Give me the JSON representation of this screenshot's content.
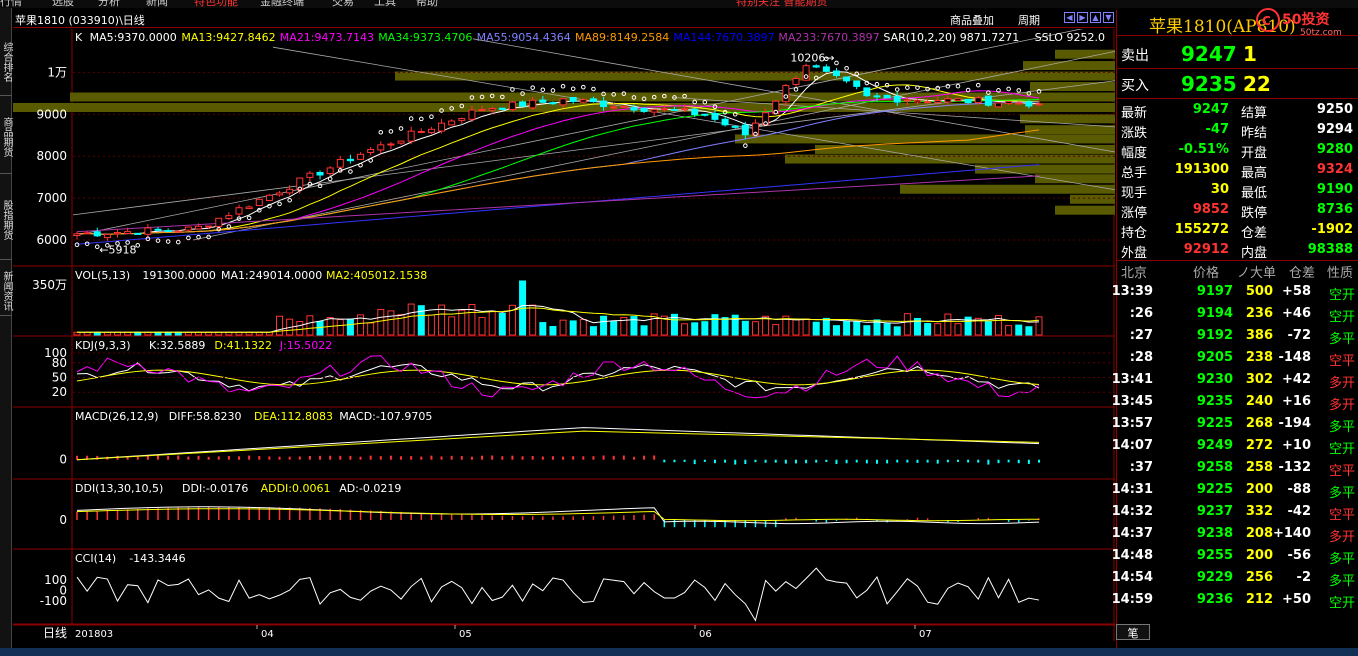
{
  "menu": {
    "items": [
      "行情",
      "选股",
      "分析",
      "新闻",
      "特色功能",
      "金融终端",
      "交易",
      "工具",
      "帮助"
    ],
    "banner": "特别关注 智能期货"
  },
  "side_tabs": [
    "综合排名",
    "商品期货",
    "股指期货",
    "新闻资讯"
  ],
  "toolbar": {
    "title": "苹果1810 (033910)\\日线",
    "overlay": "商品叠加",
    "period": "周期"
  },
  "chart": {
    "indicators": {
      "k": {
        "label": "K",
        "items": [
          {
            "text": "MA5:9370.0000",
            "color": "#ffffff"
          },
          {
            "text": "MA13:9427.8462",
            "color": "#ffff00"
          },
          {
            "text": "MA21:9473.7143",
            "color": "#ff00ff"
          },
          {
            "text": "MA34:9373.4706",
            "color": "#00ff00"
          },
          {
            "text": "MA55:9054.4364",
            "color": "#8080ff"
          },
          {
            "text": "MA89:8149.2584",
            "color": "#ff9900"
          },
          {
            "text": "MA144:7670.3897",
            "color": "#0000ff"
          },
          {
            "text": "MA233:7670.3897",
            "color": "#aa33aa"
          },
          {
            "text": "SAR(10,2,20) 9871.7271",
            "color": "#ffffff"
          },
          {
            "text": "SSLO 9252.0",
            "color": "#ffffff"
          }
        ]
      },
      "vol": {
        "label": "VOL(5,13)",
        "items": [
          {
            "text": "191300.0000",
            "color": "#ffffff"
          },
          {
            "text": "MA1:249014.0000",
            "color": "#ffffff"
          },
          {
            "text": "MA2:405012.1538",
            "color": "#ffff00"
          }
        ]
      },
      "kdj": {
        "label": "KDJ(9,3,3)",
        "items": [
          {
            "text": "K:32.5889",
            "color": "#ffffff"
          },
          {
            "text": "D:41.1322",
            "color": "#ffff00"
          },
          {
            "text": "J:15.5022",
            "color": "#ff00ff"
          }
        ]
      },
      "macd": {
        "label": "MACD(26,12,9)",
        "items": [
          {
            "text": "DIFF:58.8230",
            "color": "#ffffff"
          },
          {
            "text": "DEA:112.8083",
            "color": "#ffff00"
          },
          {
            "text": "MACD:-107.9705",
            "color": "#ffffff"
          }
        ]
      },
      "ddi": {
        "label": "DDI(13,30,10,5)",
        "items": [
          {
            "text": "DDI:-0.0176",
            "color": "#ffffff"
          },
          {
            "text": "ADDI:0.0061",
            "color": "#ffff00"
          },
          {
            "text": "AD:-0.0219",
            "color": "#ffffff"
          }
        ]
      },
      "cci": {
        "label": "CCI(14)",
        "items": [
          {
            "text": "-143.3446",
            "color": "#ffffff"
          }
        ]
      }
    },
    "price_axis": [
      "1万",
      "9000",
      "8000",
      "7000",
      "6000"
    ],
    "vol_axis": [
      "350万"
    ],
    "kdj_axis": [
      "100",
      "80",
      "50",
      "20"
    ],
    "macd_axis": [
      "0"
    ],
    "ddi_axis": [
      "0"
    ],
    "cci_axis": [
      "100",
      "0",
      "-100"
    ],
    "x_axis": [
      "201803",
      "04",
      "05",
      "06",
      "07"
    ],
    "period_label": "日线",
    "high_label": "10206→",
    "low_label": "←5918"
  },
  "right_panel": {
    "name": "苹果1810(AP810)",
    "sell": {
      "label": "卖出",
      "price": "9247",
      "qty": "1"
    },
    "buy": {
      "label": "买入",
      "price": "9235",
      "qty": "22"
    },
    "stats": [
      {
        "l1": "最新",
        "v1": "9247",
        "c1": "#00ff00",
        "l2": "结算",
        "v2": "9250",
        "c2": "#ffffff"
      },
      {
        "l1": "涨跌",
        "v1": "-47",
        "c1": "#00ff00",
        "l2": "昨结",
        "v2": "9294",
        "c2": "#ffffff"
      },
      {
        "l1": "幅度",
        "v1": "-0.51%",
        "c1": "#00ff00",
        "l2": "开盘",
        "v2": "9280",
        "c2": "#00ff00"
      },
      {
        "l1": "总手",
        "v1": "191300",
        "c1": "#ffff00",
        "l2": "最高",
        "v2": "9324",
        "c2": "#ff3333"
      },
      {
        "l1": "现手",
        "v1": "30",
        "c1": "#ffff00",
        "l2": "最低",
        "v2": "9190",
        "c2": "#00ff00"
      },
      {
        "l1": "涨停",
        "v1": "9852",
        "c1": "#ff3333",
        "l2": "跌停",
        "v2": "8736",
        "c2": "#00ff00"
      },
      {
        "l1": "持仓",
        "v1": "155272",
        "c1": "#ffff00",
        "l2": "仓差",
        "v2": "-1902",
        "c2": "#ffff00"
      },
      {
        "l1": "外盘",
        "v1": "92912",
        "c1": "#ff3333",
        "l2": "内盘",
        "v2": "98388",
        "c2": "#00ff00"
      }
    ],
    "tick_header": {
      "time": "北京",
      "price": "价格",
      "vol": "ノ大单",
      "oi": "仓差",
      "nature": "性质"
    },
    "ticks": [
      {
        "time": "13:39",
        "price": "9197",
        "vol": "500",
        "oi": "+58",
        "nature": "空开",
        "nc": "#00ff00"
      },
      {
        "time": ":26",
        "price": "9194",
        "vol": "236",
        "oi": "+46",
        "nature": "空开",
        "nc": "#00ff00"
      },
      {
        "time": ":27",
        "price": "9192",
        "vol": "386",
        "oi": "-72",
        "nature": "多平",
        "nc": "#00ff00"
      },
      {
        "time": ":28",
        "price": "9205",
        "vol": "238",
        "oi": "-148",
        "nature": "空平",
        "nc": "#ff3333"
      },
      {
        "time": "13:41",
        "price": "9230",
        "vol": "302",
        "oi": "+42",
        "nature": "多开",
        "nc": "#ff3333"
      },
      {
        "time": "13:45",
        "price": "9235",
        "vol": "240",
        "oi": "+16",
        "nature": "多开",
        "nc": "#ff3333"
      },
      {
        "time": "13:57",
        "price": "9225",
        "vol": "268",
        "oi": "-194",
        "nature": "多平",
        "nc": "#00ff00"
      },
      {
        "time": "14:07",
        "price": "9249",
        "vol": "272",
        "oi": "+10",
        "nature": "空开",
        "nc": "#00ff00"
      },
      {
        "time": ":37",
        "price": "9258",
        "vol": "258",
        "oi": "-132",
        "nature": "空平",
        "nc": "#ff3333"
      },
      {
        "time": "14:31",
        "price": "9225",
        "vol": "200",
        "oi": "-88",
        "nature": "多平",
        "nc": "#00ff00"
      },
      {
        "time": "14:32",
        "price": "9237",
        "vol": "332",
        "oi": "-42",
        "nature": "空平",
        "nc": "#ff3333"
      },
      {
        "time": "14:37",
        "price": "9238",
        "vol": "208",
        "oi": "+140",
        "nature": "多开",
        "nc": "#ff3333"
      },
      {
        "time": "14:48",
        "price": "9255",
        "vol": "200",
        "oi": "-56",
        "nature": "多平",
        "nc": "#00ff00"
      },
      {
        "time": "14:54",
        "price": "9229",
        "vol": "256",
        "oi": "-2",
        "nature": "多平",
        "nc": "#00ff00"
      },
      {
        "time": "14:59",
        "price": "9236",
        "vol": "212",
        "oi": "+50",
        "nature": "空开",
        "nc": "#00ff00"
      }
    ],
    "bottom_tab": "笔"
  },
  "logo": {
    "text": "50投资",
    "sub": "50tz.com"
  },
  "colors": {
    "up": "#ff3333",
    "down": "#00ffff",
    "border": "#8b0000",
    "yellow": "#ffff00",
    "green": "#00ff00"
  }
}
